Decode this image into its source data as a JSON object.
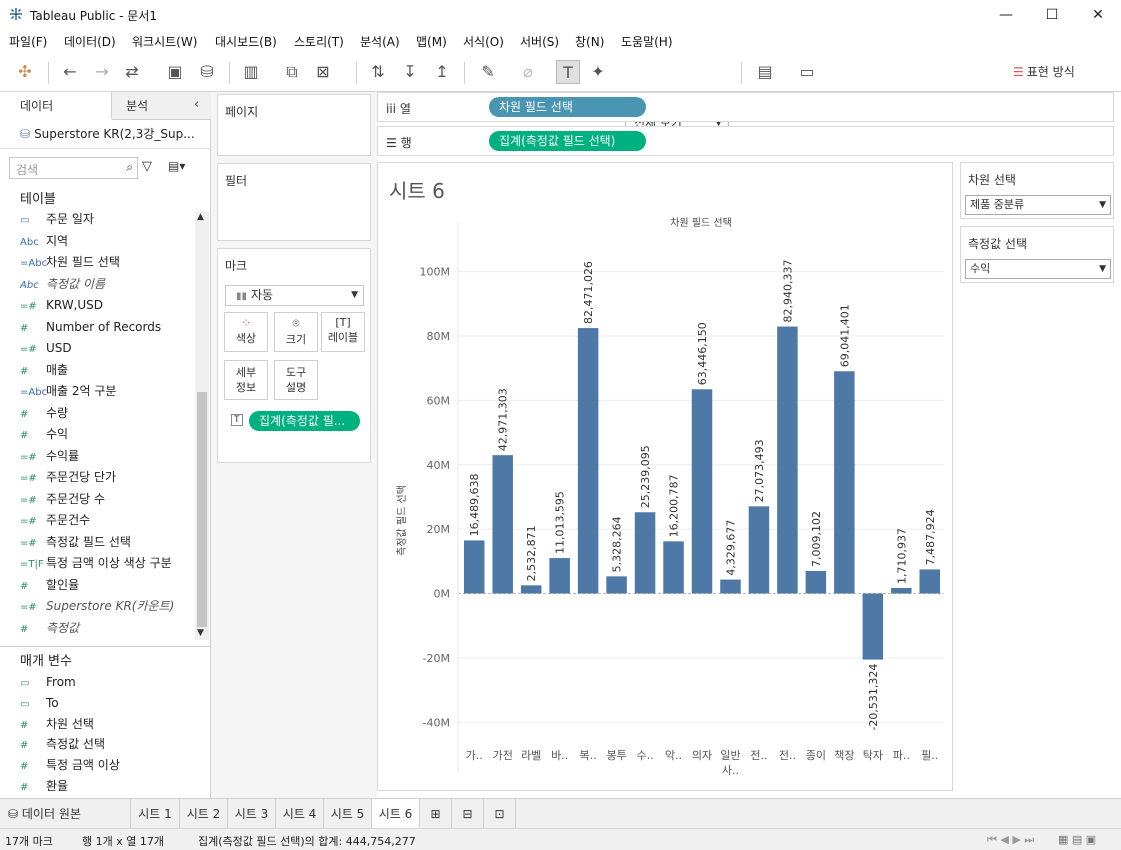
{
  "window": {
    "title": "Tableau Public - 문서1",
    "minimize": "—",
    "maximize": "☐",
    "close": "✕"
  },
  "menu": [
    "파일(F)",
    "데이터(D)",
    "워크시트(W)",
    "대시보드(B)",
    "스토리(T)",
    "분석(A)",
    "맵(M)",
    "서식(O)",
    "서버(S)",
    "창(N)",
    "도움말(H)"
  ],
  "toolbar": {
    "view_select": "전체 보기",
    "show_me": "표현 방식"
  },
  "left": {
    "tab_data": "데이터",
    "tab_analysis": "분석",
    "datasource": "Superstore KR(2,3강_Sup...",
    "search_placeholder": "검색",
    "tables_header": "테이블",
    "fields": [
      {
        "icon": "calendar",
        "label": "주문 일자",
        "italic": false
      },
      {
        "icon": "Abc",
        "label": "지역",
        "italic": false
      },
      {
        "icon": "=Abc",
        "label": "차원 필드 선택",
        "italic": false
      },
      {
        "icon": "Abc",
        "label": "측정값 이름",
        "italic": true
      },
      {
        "icon": "=#",
        "label": "KRW,USD",
        "italic": false
      },
      {
        "icon": "#",
        "label": "Number of Records",
        "italic": false
      },
      {
        "icon": "=#",
        "label": "USD",
        "italic": false
      },
      {
        "icon": "#",
        "label": "매출",
        "italic": false
      },
      {
        "icon": "=Abc",
        "label": "매출 2억 구분",
        "italic": false
      },
      {
        "icon": "#",
        "label": "수량",
        "italic": false
      },
      {
        "icon": "#",
        "label": "수익",
        "italic": false
      },
      {
        "icon": "=#",
        "label": "수익률",
        "italic": false
      },
      {
        "icon": "=#",
        "label": "주문건당 단가",
        "italic": false
      },
      {
        "icon": "=#",
        "label": "주문건당 수",
        "italic": false
      },
      {
        "icon": "=#",
        "label": "주문건수",
        "italic": false
      },
      {
        "icon": "=#",
        "label": "측정값 필드 선택",
        "italic": false
      },
      {
        "icon": "=T|F",
        "label": "특정 금액 이상 색상 구분",
        "italic": false
      },
      {
        "icon": "#",
        "label": "할인율",
        "italic": false
      },
      {
        "icon": "=#",
        "label": "Superstore KR(카운트)",
        "italic": true
      },
      {
        "icon": "#",
        "label": "측정값",
        "italic": true
      }
    ],
    "params_header": "매개 변수",
    "params": [
      {
        "icon": "calendar",
        "label": "From"
      },
      {
        "icon": "calendar",
        "label": "To"
      },
      {
        "icon": "#",
        "label": "차원 선택"
      },
      {
        "icon": "#",
        "label": "측정값 선택"
      },
      {
        "icon": "#",
        "label": "특정 금액 이상"
      },
      {
        "icon": "#",
        "label": "환율"
      }
    ]
  },
  "cards": {
    "pages": "페이지",
    "filters": "필터",
    "marks": "마크",
    "mark_type": "자동",
    "color": "색상",
    "size": "크기",
    "label": "레이블",
    "detail": "세부\n정보",
    "tooltip": "도구\n설명",
    "marks_pill": "집계(측정값 필..."
  },
  "shelves": {
    "columns_label": "열",
    "rows_label": "행",
    "columns_pill": "차원 필드 선택",
    "rows_pill": "집계(측정값 필드 선택)"
  },
  "sheet": {
    "title": "시트 6"
  },
  "right": {
    "dim_title": "차원 선택",
    "dim_value": "제품 중분류",
    "measure_title": "측정값 선택",
    "measure_value": "수익"
  },
  "sheet_tabs": [
    "데이터 원본",
    "시트 1",
    "시트 2",
    "시트 3",
    "시트 4",
    "시트 5",
    "시트 6"
  ],
  "status": {
    "marks": "17개 마크",
    "rows_cols": "행 1개 x 열 17개",
    "sum": "집계(측정값 필드 선택)의 합계: 444,754,277"
  },
  "colors": {
    "bar": "#4e79a7",
    "pill_blue": "#4996b2",
    "pill_green": "#00b180"
  },
  "chart_data": {
    "type": "bar",
    "title": "차원 필드 선택",
    "ylabel": "측정값 필드 선택",
    "categories": [
      "가..",
      "가전",
      "라벨",
      "바..",
      "복..",
      "봉투",
      "수..",
      "악..",
      "의자",
      "일반\n사..",
      "전..",
      "전..",
      "종이",
      "책장",
      "탁자",
      "파..",
      "필.."
    ],
    "values": [
      16489638,
      42971303,
      2532871,
      11013595,
      82471026,
      5328264,
      25239095,
      16200787,
      63446150,
      4329677,
      27073493,
      82940337,
      7009102,
      69041401,
      -20531324,
      1710937,
      7487924
    ],
    "value_labels": [
      "16,489,638",
      "42,971,303",
      "2,532,871",
      "11,013,595",
      "82,471,026",
      "5,328,264",
      "25,239,095",
      "16,200,787",
      "63,446,150",
      "4,329,677",
      "27,073,493",
      "82,940,337",
      "7,009,102",
      "69,041,401",
      "-20,531,324",
      "1,710,937",
      "7,487,924"
    ],
    "yticks": [
      -40000000,
      -20000000,
      0,
      20000000,
      40000000,
      60000000,
      80000000,
      100000000
    ],
    "ytick_labels": [
      "-40M",
      "-20M",
      "0M",
      "20M",
      "40M",
      "60M",
      "80M",
      "100M"
    ],
    "ylim": [
      -48000000,
      112000000
    ],
    "grid": true
  }
}
